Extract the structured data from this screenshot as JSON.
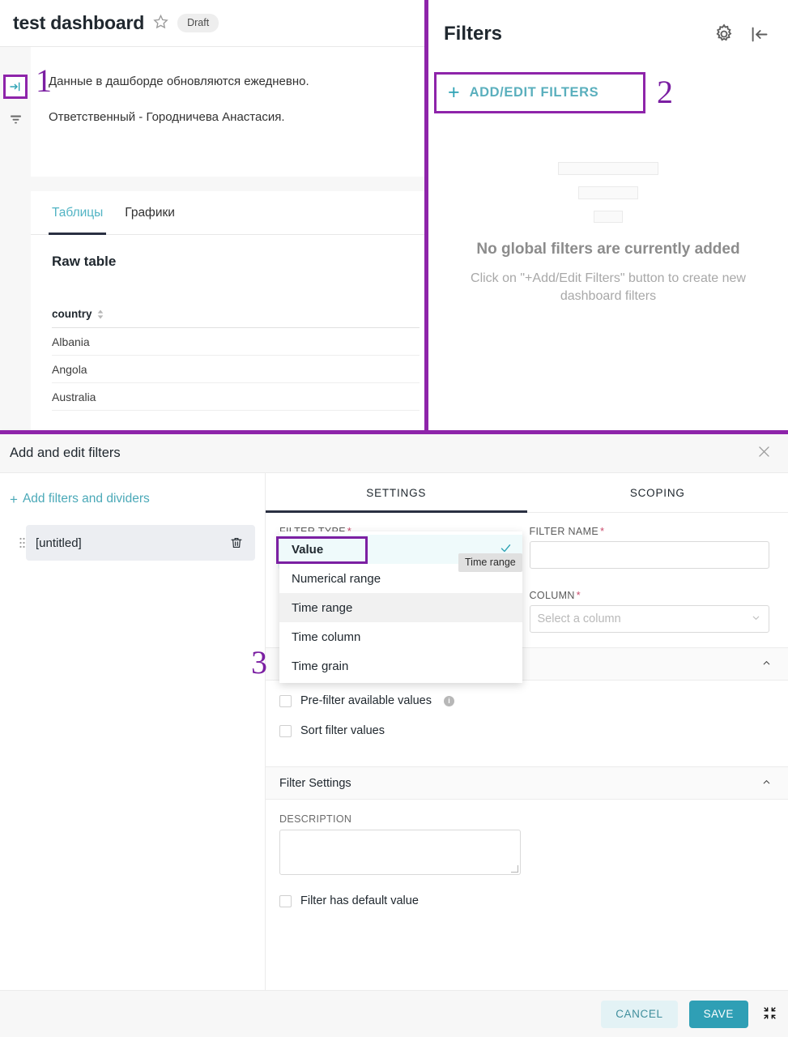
{
  "dashboard": {
    "title": "test dashboard",
    "star_icon": "star-outline-icon",
    "status_badge": "Draft",
    "markdown_lines": [
      "Данные в дашборде обновляются ежедневно.",
      "Ответственный - Городничева Анастасия."
    ],
    "rail": {
      "expand_icon": "expand-panel-right-icon",
      "funnel_icon": "funnel-icon"
    },
    "tabs": [
      {
        "label": "Таблицы",
        "active": true
      },
      {
        "label": "Графики",
        "active": false
      }
    ],
    "chart_title": "Raw table",
    "table": {
      "columns": [
        "country"
      ],
      "sort_icon": "sort-caret-icon",
      "rows": [
        "Albania",
        "Angola",
        "Australia"
      ]
    }
  },
  "filters_panel": {
    "title": "Filters",
    "gear_icon": "gear-icon",
    "collapse_icon": "collapse-panel-left-icon",
    "add_edit_button": {
      "plus_icon": "plus-icon",
      "label": "ADD/EDIT FILTERS"
    },
    "empty_state": {
      "title": "No global filters are currently added",
      "subtitle": "Click on \"+Add/Edit Filters\" button to create new dashboard filters"
    }
  },
  "annotations": {
    "one": "1",
    "two": "2",
    "three": "3",
    "color": "#7b1fa2"
  },
  "modal": {
    "title": "Add and edit filters",
    "close_icon": "close-icon",
    "left": {
      "add_link": {
        "plus_icon": "plus-icon",
        "label": "Add filters and dividers"
      },
      "items": [
        {
          "drag_icon": "drag-handle-icon",
          "label": "[untitled]",
          "delete_icon": "trash-icon"
        }
      ]
    },
    "tabs": [
      {
        "label": "SETTINGS",
        "active": true
      },
      {
        "label": "SCOPING",
        "active": false
      }
    ],
    "fields": {
      "filter_type": {
        "label": "FILTER TYPE",
        "required": "*",
        "value": "",
        "placeholder": "Value",
        "search_icon": "search-icon"
      },
      "filter_name": {
        "label": "FILTER NAME",
        "required": "*",
        "value": "",
        "placeholder": ""
      },
      "column": {
        "label": "COLUMN",
        "required": "*",
        "value": "",
        "placeholder": "Select a column",
        "caret_icon": "chevron-down-icon"
      }
    },
    "filter_type_dropdown": {
      "options": [
        {
          "label": "Value",
          "selected": true,
          "hovered": false
        },
        {
          "label": "Numerical range",
          "selected": false,
          "hovered": false
        },
        {
          "label": "Time range",
          "selected": false,
          "hovered": true
        },
        {
          "label": "Time column",
          "selected": false,
          "hovered": false
        },
        {
          "label": "Time grain",
          "selected": false,
          "hovered": false
        }
      ],
      "check_icon": "check-icon",
      "tooltip": "Time range"
    },
    "sections": [
      {
        "title": "",
        "caret_icon": "chevron-up-icon",
        "checkboxes": [
          {
            "label": "Pre-filter available values",
            "checked": false,
            "info_icon": "info-icon",
            "info_glyph": "i"
          },
          {
            "label": "Sort filter values",
            "checked": false,
            "info_icon": ""
          }
        ]
      },
      {
        "title": "Filter Settings",
        "caret_icon": "chevron-up-icon",
        "description_label": "DESCRIPTION",
        "description_value": "",
        "checkboxes": [
          {
            "label": "Filter has default value",
            "checked": false,
            "info_icon": ""
          }
        ]
      }
    ],
    "footer": {
      "cancel_label": "CANCEL",
      "save_label": "SAVE",
      "resize_icon": "resize-collapse-icon"
    }
  },
  "colors": {
    "accent_teal": "#2f9fb5",
    "annotation_purple": "#8e24aa",
    "tab_underline": "#2a3042",
    "required_red": "#c94a6b"
  }
}
